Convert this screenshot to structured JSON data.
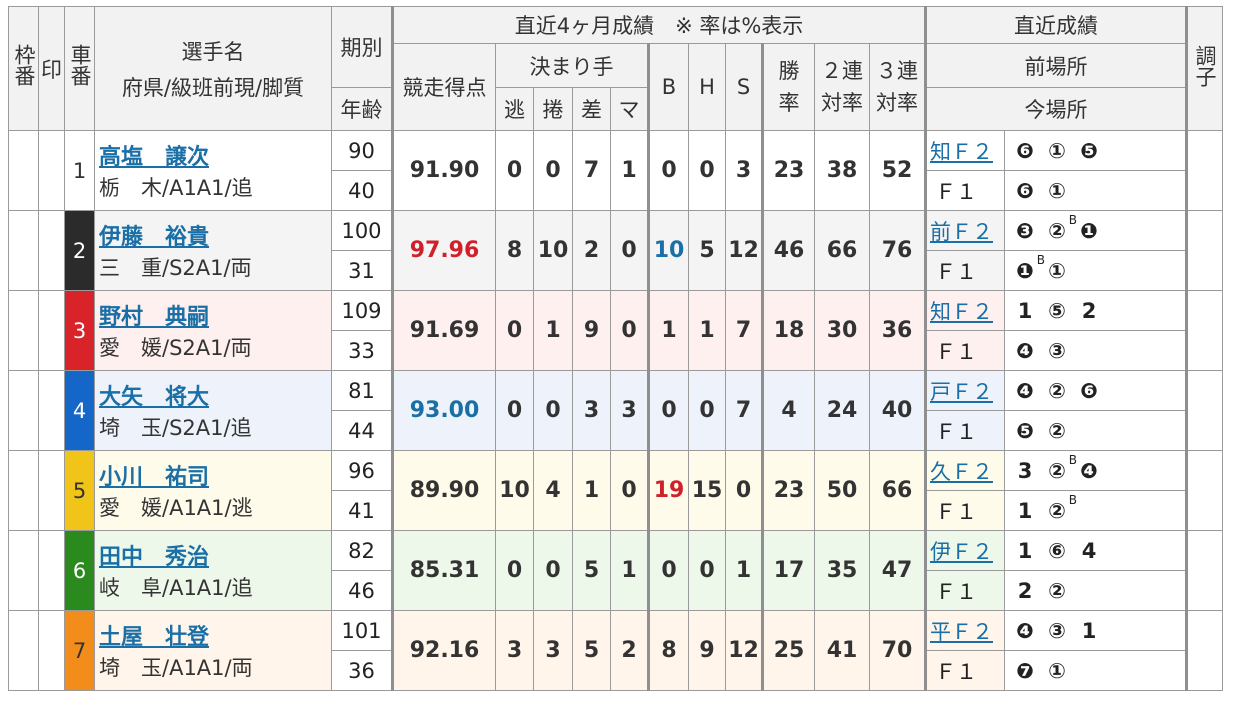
{
  "colors": {
    "link": "#1a6fa6",
    "score_red": "#d0202a",
    "score_blue": "#1a6fa6",
    "row_bg": [
      "#ffffff",
      "#f4f4f4",
      "#fff0f0",
      "#eef3fb",
      "#fffbeb",
      "#eef8ea",
      "#fff5ea"
    ],
    "car_bg": [
      "#ffffff",
      "#2b2b2b",
      "#d8232a",
      "#1466c9",
      "#f0c419",
      "#2a8a1e",
      "#f28c1a"
    ],
    "car_fg": [
      "#333333",
      "#ffffff",
      "#ffffff",
      "#ffffff",
      "#333333",
      "#ffffff",
      "#333333"
    ]
  },
  "header": {
    "waku": "枠番",
    "mark": "印",
    "car": "車番",
    "name_line1": "選手名",
    "name_line2": "府県/級班前現/脚質",
    "term": "期別",
    "age": "年齢",
    "recent4": "直近4ヶ月成績　※ 率は%表示",
    "score": "競走得点",
    "kimarite": "決まり手",
    "nige": "逃",
    "makuri": "捲",
    "sashi": "差",
    "mark_col": "マ",
    "b": "B",
    "h": "H",
    "s": "S",
    "win_rate": "勝率",
    "top2": "２連対率",
    "top3": "３連対率",
    "recent": "直近成績",
    "prev_venue": "前場所",
    "curr_venue": "今場所",
    "condition": "調子"
  },
  "riders": [
    {
      "car": "1",
      "name": "高塩　譲次",
      "sub": "栃　木/A1A1/追",
      "term": "90",
      "age": "40",
      "score": "91.90",
      "score_color": "normal",
      "nige": "0",
      "makuri": "0",
      "sashi": "7",
      "mark": "1",
      "b": "0",
      "h": "0",
      "s": "3",
      "b_color": "normal",
      "win": "23",
      "top2": "38",
      "top3": "52",
      "prev_venue": "知Ｆ２",
      "prev_results": [
        "❻",
        "①",
        "❺"
      ],
      "prev_sup": [
        "",
        "",
        ""
      ],
      "curr_venue": "Ｆ１",
      "curr_results": [
        "❻",
        "①"
      ],
      "curr_sup": [
        "",
        ""
      ]
    },
    {
      "car": "2",
      "name": "伊藤　裕貴",
      "sub": "三　重/S2A1/両",
      "term": "100",
      "age": "31",
      "score": "97.96",
      "score_color": "red",
      "nige": "8",
      "makuri": "10",
      "sashi": "2",
      "mark": "0",
      "b": "10",
      "h": "5",
      "s": "12",
      "b_color": "blue",
      "win": "46",
      "top2": "66",
      "top3": "76",
      "prev_venue": "前Ｆ２",
      "prev_results": [
        "❸",
        "②",
        "❶"
      ],
      "prev_sup": [
        "",
        "B",
        ""
      ],
      "curr_venue": "Ｆ１",
      "curr_results": [
        "❶",
        "①"
      ],
      "curr_sup": [
        "B",
        ""
      ]
    },
    {
      "car": "3",
      "name": "野村　典嗣",
      "sub": "愛　媛/S2A1/両",
      "term": "109",
      "age": "33",
      "score": "91.69",
      "score_color": "normal",
      "nige": "0",
      "makuri": "1",
      "sashi": "9",
      "mark": "0",
      "b": "1",
      "h": "1",
      "s": "7",
      "b_color": "normal",
      "win": "18",
      "top2": "30",
      "top3": "36",
      "prev_venue": "知Ｆ２",
      "prev_results": [
        "1",
        "⑤",
        "2"
      ],
      "prev_sup": [
        "",
        "",
        ""
      ],
      "curr_venue": "Ｆ１",
      "curr_results": [
        "❹",
        "③"
      ],
      "curr_sup": [
        "",
        ""
      ]
    },
    {
      "car": "4",
      "name": "大矢　将大",
      "sub": "埼　玉/S2A1/追",
      "term": "81",
      "age": "44",
      "score": "93.00",
      "score_color": "blue",
      "nige": "0",
      "makuri": "0",
      "sashi": "3",
      "mark": "3",
      "b": "0",
      "h": "0",
      "s": "7",
      "b_color": "normal",
      "win": "4",
      "top2": "24",
      "top3": "40",
      "prev_venue": "戸Ｆ２",
      "prev_results": [
        "❹",
        "②",
        "❻"
      ],
      "prev_sup": [
        "",
        "",
        ""
      ],
      "curr_venue": "Ｆ１",
      "curr_results": [
        "❺",
        "②"
      ],
      "curr_sup": [
        "",
        ""
      ]
    },
    {
      "car": "5",
      "name": "小川　祐司",
      "sub": "愛　媛/A1A1/逃",
      "term": "96",
      "age": "41",
      "score": "89.90",
      "score_color": "normal",
      "nige": "10",
      "makuri": "4",
      "sashi": "1",
      "mark": "0",
      "b": "19",
      "h": "15",
      "s": "0",
      "b_color": "red",
      "win": "23",
      "top2": "50",
      "top3": "66",
      "prev_venue": "久Ｆ２",
      "prev_results": [
        "3",
        "②",
        "❹"
      ],
      "prev_sup": [
        "",
        "B",
        ""
      ],
      "curr_venue": "Ｆ１",
      "curr_results": [
        "1",
        "②"
      ],
      "curr_sup": [
        "",
        "B"
      ]
    },
    {
      "car": "6",
      "name": "田中　秀治",
      "sub": "岐　阜/A1A1/追",
      "term": "82",
      "age": "46",
      "score": "85.31",
      "score_color": "normal",
      "nige": "0",
      "makuri": "0",
      "sashi": "5",
      "mark": "1",
      "b": "0",
      "h": "0",
      "s": "1",
      "b_color": "normal",
      "win": "17",
      "top2": "35",
      "top3": "47",
      "prev_venue": "伊Ｆ２",
      "prev_results": [
        "1",
        "⑥",
        "4"
      ],
      "prev_sup": [
        "",
        "",
        ""
      ],
      "curr_venue": "Ｆ１",
      "curr_results": [
        "2",
        "②"
      ],
      "curr_sup": [
        "",
        ""
      ]
    },
    {
      "car": "7",
      "name": "土屋　壮登",
      "sub": "埼　玉/A1A1/両",
      "term": "101",
      "age": "36",
      "score": "92.16",
      "score_color": "normal",
      "nige": "3",
      "makuri": "3",
      "sashi": "5",
      "mark": "2",
      "b": "8",
      "h": "9",
      "s": "12",
      "b_color": "normal",
      "win": "25",
      "top2": "41",
      "top3": "70",
      "prev_venue": "平Ｆ２",
      "prev_results": [
        "❹",
        "③",
        "1"
      ],
      "prev_sup": [
        "",
        "",
        ""
      ],
      "curr_venue": "Ｆ１",
      "curr_results": [
        "❼",
        "①"
      ],
      "curr_sup": [
        "",
        ""
      ]
    }
  ]
}
